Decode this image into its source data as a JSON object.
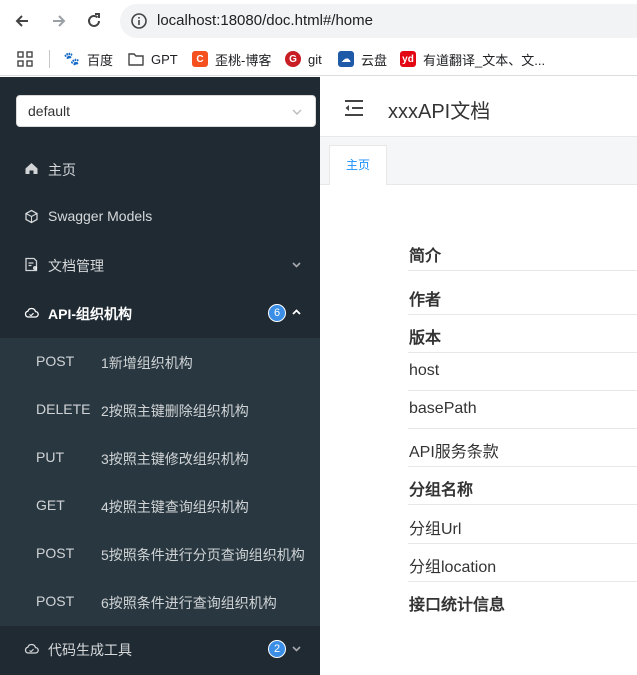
{
  "browser": {
    "url": "localhost:18080/doc.html#/home",
    "bookmarks": [
      {
        "label": "百度",
        "icon": "baidu-paw-icon",
        "color": "#2932e1"
      },
      {
        "label": "GPT",
        "icon": "folder-icon",
        "color": "#5f6368"
      },
      {
        "label": "歪桃-博客",
        "icon": "blog-c-icon",
        "color": "#f4511e"
      },
      {
        "label": "git",
        "icon": "gitee-icon",
        "color": "#c71d23"
      },
      {
        "label": "云盘",
        "icon": "cloud-drive-icon",
        "color": "#1e5aa8"
      },
      {
        "label": "有道翻译_文本、文...",
        "icon": "youdao-icon",
        "color": "#e30613"
      }
    ]
  },
  "sidebar": {
    "group_select": "default",
    "menu": [
      {
        "label": "主页",
        "icon": "home-icon"
      },
      {
        "label": "Swagger Models",
        "icon": "models-icon"
      },
      {
        "label": "文档管理",
        "icon": "doc-manage-icon"
      },
      {
        "label": "API-组织机构",
        "icon": "cloud-icon",
        "badge": "6"
      },
      {
        "label": "代码生成工具",
        "icon": "cloud-icon",
        "badge": "2"
      }
    ],
    "api_items": [
      {
        "method": "POST",
        "name": "1新增组织机构"
      },
      {
        "method": "DELETE",
        "name": "2按照主键删除组织机构"
      },
      {
        "method": "PUT",
        "name": "3按照主键修改组织机构"
      },
      {
        "method": "GET",
        "name": "4按照主键查询组织机构"
      },
      {
        "method": "POST",
        "name": "5按照条件进行分页查询组织机构"
      },
      {
        "method": "POST",
        "name": "6按照条件进行查询组织机构"
      }
    ]
  },
  "main": {
    "title": "xxxAPI文档",
    "tab": "主页",
    "info_rows": [
      "简介",
      "作者",
      "版本",
      "host",
      "basePath",
      "API服务条款",
      "分组名称",
      "分组Url",
      "分组location",
      "接口统计信息"
    ]
  },
  "colors": {
    "sidebar_bg": "#1f2a33",
    "submenu_bg": "#283740",
    "badge_bg": "#3a8ee6",
    "tab_active": "#1890ff"
  }
}
